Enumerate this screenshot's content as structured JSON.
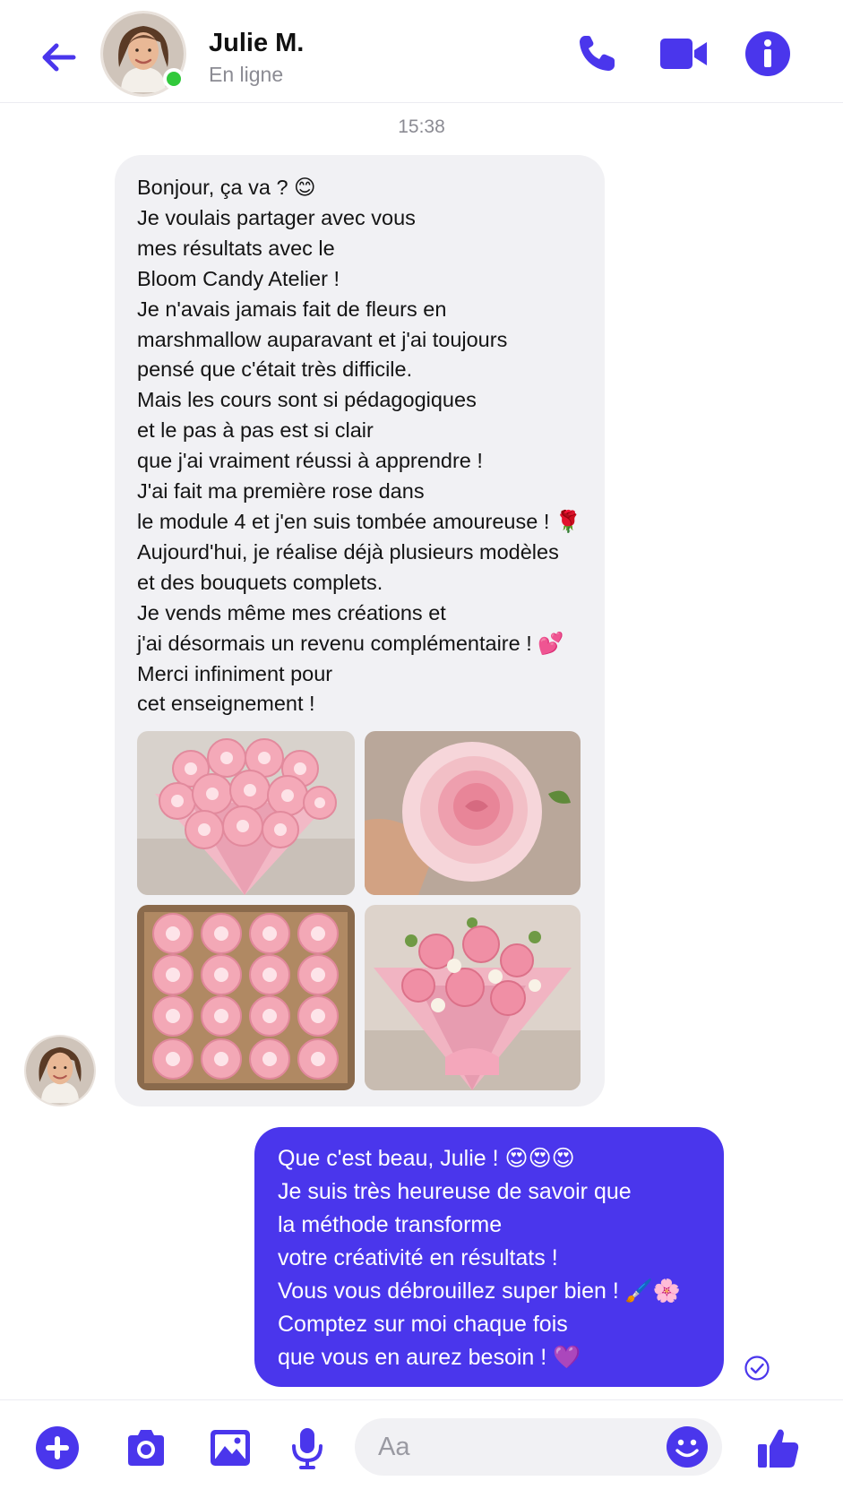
{
  "header": {
    "contact_name": "Julie M.",
    "status": "En ligne",
    "accent_color": "#4a36ec",
    "online_color": "#31c93b",
    "icons": [
      "back-arrow-icon",
      "phone-icon",
      "video-camera-icon",
      "info-icon"
    ]
  },
  "conversation": {
    "timestamp": "15:38",
    "incoming_message": "Bonjour, ça va ? 😊\nJe voulais partager avec vous\nmes résultats avec le\nBloom Candy Atelier !\nJe n'avais jamais fait de fleurs en\nmarshmallow auparavant et j'ai toujours\npensé que c'était très difficile.\nMais les cours sont si pédagogiques\net le pas à pas est si clair\nque j'ai vraiment réussi à apprendre !\nJ'ai fait ma première rose dans\nle module 4 et j'en suis tombée amoureuse ! 🌹\nAujourd'hui, je réalise déjà plusieurs modèles\net des bouquets complets.\nJe vends même mes créations et\nj'ai désormais un revenu complémentaire ! 💕\nMerci infiniment pour\ncet enseignement !",
    "photos": [
      "pink-rose-bouquet-photo",
      "single-pink-rose-photo",
      "box-of-roses-photo",
      "mixed-flower-bouquet-photo"
    ],
    "outgoing_message": "Que c'est beau, Julie ! 😍😍😍\nJe suis très heureuse de savoir que\nla méthode transforme\nvotre créativité en résultats !\nVous vous débrouillez super bien ! 🖌️🌸\nComptez sur moi chaque fois\nque vous en aurez besoin ! 💜",
    "outgoing_color": "#4a36ec",
    "incoming_color": "#f1f1f4"
  },
  "composer": {
    "placeholder": "Aa",
    "icons": [
      "plus-icon",
      "camera-icon",
      "image-icon",
      "microphone-icon",
      "smiley-icon",
      "thumbs-up-icon"
    ]
  }
}
